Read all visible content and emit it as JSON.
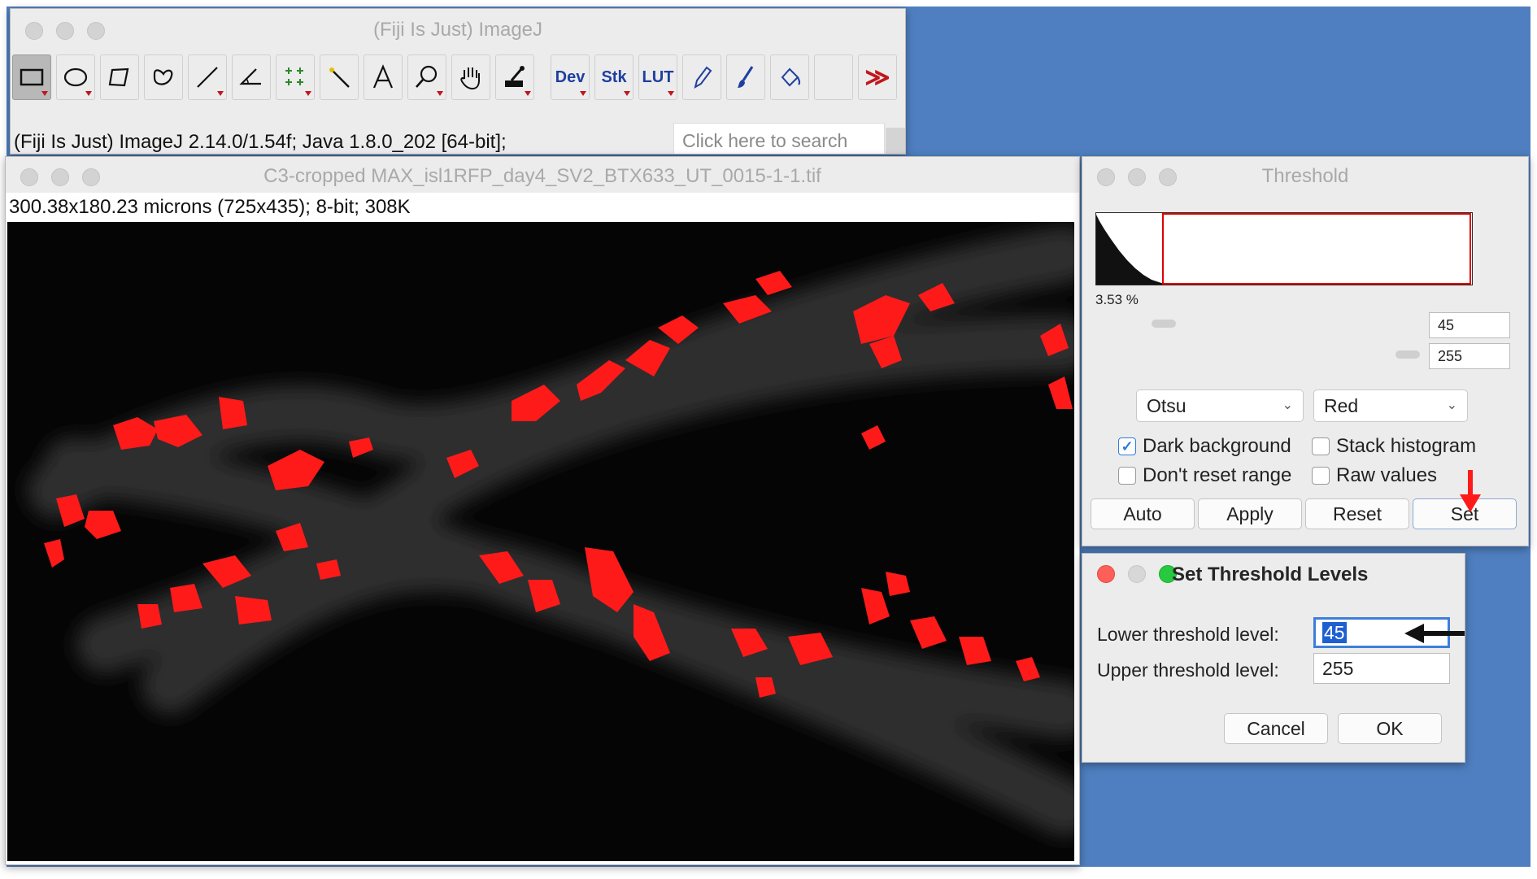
{
  "main_window": {
    "title": "(Fiji Is Just) ImageJ",
    "status": "(Fiji Is Just) ImageJ 2.14.0/1.54f; Java 1.8.0_202 [64-bit];",
    "search_placeholder": "Click here to search",
    "tools": [
      {
        "name": "rectangle-tool",
        "selected": true
      },
      {
        "name": "oval-tool"
      },
      {
        "name": "polygon-tool"
      },
      {
        "name": "freehand-tool"
      },
      {
        "name": "line-tool"
      },
      {
        "name": "angle-tool"
      },
      {
        "name": "multipoint-tool"
      },
      {
        "name": "wand-tool"
      },
      {
        "name": "text-tool"
      },
      {
        "name": "magnifier-tool"
      },
      {
        "name": "hand-tool"
      },
      {
        "name": "color-picker-tool"
      },
      {
        "name": "dev-menu",
        "label": "Dev"
      },
      {
        "name": "stk-menu",
        "label": "Stk"
      },
      {
        "name": "lut-menu",
        "label": "LUT"
      },
      {
        "name": "pencil-tool"
      },
      {
        "name": "brush-tool"
      },
      {
        "name": "flood-fill-tool"
      },
      {
        "name": "empty-slot"
      },
      {
        "name": "more-tools",
        "label": "≫"
      }
    ]
  },
  "image_window": {
    "title": "C3-cropped MAX_isl1RFP_day4_SV2_BTX633_UT_0015-1-1.tif",
    "info": "300.38x180.23 microns (725x435); 8-bit; 308K"
  },
  "threshold": {
    "title": "Threshold",
    "percent": "3.53 %",
    "min_value": "45",
    "max_value": "255",
    "method": "Otsu",
    "display": "Red",
    "dark_background": {
      "label": "Dark background",
      "checked": true
    },
    "stack_histogram": {
      "label": "Stack histogram",
      "checked": false
    },
    "dont_reset_range": {
      "label": "Don't reset range",
      "checked": false
    },
    "raw_values": {
      "label": "Raw values",
      "checked": false
    },
    "buttons": {
      "auto": "Auto",
      "apply": "Apply",
      "reset": "Reset",
      "set": "Set"
    }
  },
  "dialog": {
    "title": "Set Threshold Levels",
    "lower_label": "Lower threshold level:",
    "lower_value": "45",
    "upper_label": "Upper threshold level:",
    "upper_value": "255",
    "cancel": "Cancel",
    "ok": "OK"
  },
  "colors": {
    "desktop": "#4f7fc0",
    "threshold_red": "#ff1a1a",
    "accent_blue": "#2f7bde"
  }
}
